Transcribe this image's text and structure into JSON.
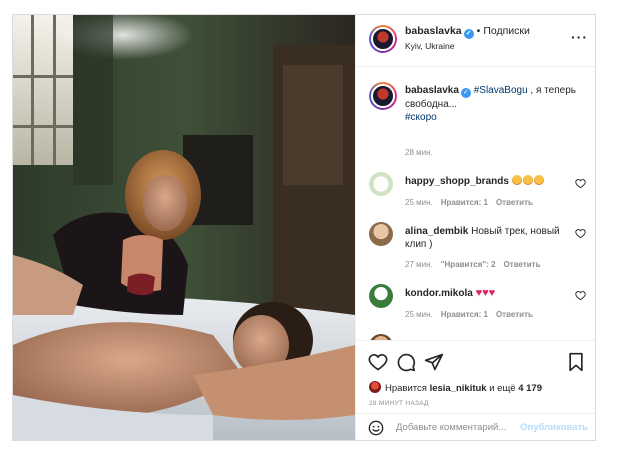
{
  "post": {
    "username": "babaslavka",
    "follow_label": "Подписки",
    "location": "Kyiv, Ukraine",
    "more_icon": "more-options-icon"
  },
  "caption": {
    "username": "babaslavka",
    "hashtag": "#SlavaBogu",
    "text": " , я теперь свободна...",
    "hashtag2": "#скоро",
    "time": "28 мин."
  },
  "comments": [
    {
      "username": "happy_shopp_brands",
      "text": "",
      "emoji_count": 3,
      "time": "25 мин.",
      "likes": "Нравится: 1",
      "reply": "Ответить"
    },
    {
      "username": "alina_dembik",
      "text": "Новый трек, новый клип )",
      "time": "27 мин.",
      "likes": "\"Нравится\": 2",
      "reply": "Ответить"
    },
    {
      "username": "kondor.mikola",
      "text": "♥♥♥",
      "time": "25 мин.",
      "likes": "Нравится: 1",
      "reply": "Ответить"
    }
  ],
  "likes": {
    "prefix": "Нравится",
    "user": "lesia_nikituk",
    "connector": "и ещё",
    "count": "4 179"
  },
  "time_ago": "28 МИНУТ НАЗАД",
  "add_comment": {
    "placeholder": "Добавьте комментарий...",
    "publish_label": "Опубликовать"
  },
  "colors": {
    "verified": "#3897f0",
    "link": "#00376b",
    "publish_disabled": "#b3dbff",
    "heart_emoji": "#e0245e"
  }
}
